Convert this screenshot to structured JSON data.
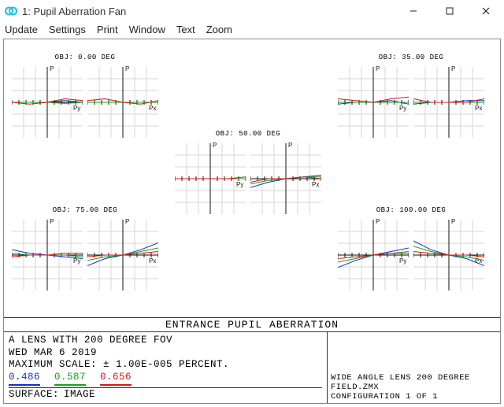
{
  "window": {
    "title": "1: Pupil Aberration Fan"
  },
  "menu": {
    "update": "Update",
    "settings": "Settings",
    "print": "Print",
    "window": "Window",
    "text": "Text",
    "zoom": "Zoom"
  },
  "caption": "ENTRANCE PUPIL ABERRATION",
  "info": {
    "line1": "A LENS WITH 200 DEGREE FOV",
    "date": "WED MAR 6 2019",
    "scale": "MAXIMUM SCALE: ± 1.00E-005 PERCENT.",
    "surface_label": "SURFACE:",
    "surface_value": "IMAGE",
    "file": "WIDE ANGLE LENS 200 DEGREE FIELD.ZMX",
    "config": "CONFIGURATION 1 OF 1"
  },
  "wavelengths": {
    "blue": "0.486",
    "green": "0.587",
    "red": "0.656"
  },
  "pair_titles": {
    "obj0": "OBJ: 0.00 DEG",
    "obj35": "OBJ: 35.00 DEG",
    "obj50": "OBJ: 50.00 DEG",
    "obj75": "OBJ: 75.00 DEG",
    "obj100": "OBJ: 100.00 DEG"
  },
  "axis_labels": {
    "py_top": "P",
    "py_right": "Py",
    "px_top": "P",
    "px_right": "Px"
  },
  "chart_data": {
    "type": "line",
    "note": "Ray-fan aberration plots. Each field angle has two fans (Y-fan over Py, X-fan over Px). Pupil coordinate runs -1..1, vertical scale ±1.00E-005 percent. Curves are shown for three wavelengths (0.486 µm blue, 0.587 µm green, 0.656 µm red). Values below are approximate readings in units of the full vertical scale (1.0 = +1E-5%, -1.0 = -1E-5%).",
    "pupil": [
      -1.0,
      -0.5,
      0.0,
      0.5,
      1.0
    ],
    "fields": [
      {
        "angle_deg": 0.0,
        "y_fan": {
          "blue": [
            0.0,
            0.0,
            0.0,
            0.05,
            0.0
          ],
          "green": [
            0.0,
            0.0,
            0.0,
            -0.03,
            0.0
          ],
          "red": [
            0.0,
            -0.05,
            0.0,
            0.1,
            0.05
          ]
        },
        "x_fan": {
          "blue": [
            0.0,
            0.0,
            0.0,
            0.0,
            0.0
          ],
          "green": [
            0.0,
            0.0,
            0.0,
            0.0,
            0.0
          ],
          "red": [
            0.05,
            0.1,
            0.0,
            -0.05,
            0.05
          ]
        }
      },
      {
        "angle_deg": 35.0,
        "y_fan": {
          "blue": [
            -0.05,
            0.0,
            0.0,
            0.05,
            -0.05
          ],
          "green": [
            0.0,
            0.0,
            0.0,
            0.0,
            0.0
          ],
          "red": [
            0.1,
            0.05,
            0.0,
            0.1,
            0.15
          ]
        },
        "x_fan": {
          "blue": [
            -0.05,
            0.0,
            0.0,
            0.05,
            0.05
          ],
          "green": [
            0.0,
            0.0,
            0.0,
            0.0,
            0.0
          ],
          "red": [
            0.1,
            0.0,
            0.0,
            0.0,
            0.1
          ]
        }
      },
      {
        "angle_deg": 50.0,
        "y_fan": {
          "blue": [
            0.0,
            0.0,
            0.0,
            0.0,
            0.0
          ],
          "green": [
            0.0,
            0.0,
            0.0,
            0.0,
            0.0
          ],
          "red": [
            0.0,
            0.0,
            0.0,
            0.0,
            0.05
          ]
        },
        "x_fan": {
          "blue": [
            -0.25,
            -0.1,
            0.0,
            0.05,
            0.1
          ],
          "green": [
            -0.15,
            -0.05,
            0.0,
            0.05,
            0.05
          ],
          "red": [
            -0.1,
            0.0,
            0.0,
            0.05,
            0.0
          ]
        }
      },
      {
        "angle_deg": 75.0,
        "y_fan": {
          "blue": [
            0.15,
            0.05,
            0.0,
            -0.05,
            -0.1
          ],
          "green": [
            0.05,
            0.0,
            0.0,
            0.0,
            -0.05
          ],
          "red": [
            -0.05,
            0.0,
            0.0,
            0.05,
            0.05
          ]
        },
        "x_fan": {
          "blue": [
            -0.3,
            -0.1,
            0.0,
            0.15,
            0.35
          ],
          "green": [
            -0.15,
            -0.05,
            0.0,
            0.1,
            0.2
          ],
          "red": [
            -0.05,
            0.0,
            0.0,
            0.05,
            0.1
          ]
        }
      },
      {
        "angle_deg": 100.0,
        "y_fan": {
          "blue": [
            -0.35,
            -0.15,
            0.0,
            0.1,
            0.2
          ],
          "green": [
            -0.2,
            -0.1,
            0.0,
            0.05,
            0.1
          ],
          "red": [
            -0.1,
            -0.05,
            0.0,
            0.05,
            0.05
          ]
        },
        "x_fan": {
          "blue": [
            0.4,
            0.15,
            0.0,
            -0.1,
            -0.3
          ],
          "green": [
            0.25,
            0.1,
            0.0,
            -0.05,
            -0.15
          ],
          "red": [
            0.1,
            0.05,
            0.0,
            0.0,
            -0.05
          ]
        }
      }
    ]
  }
}
